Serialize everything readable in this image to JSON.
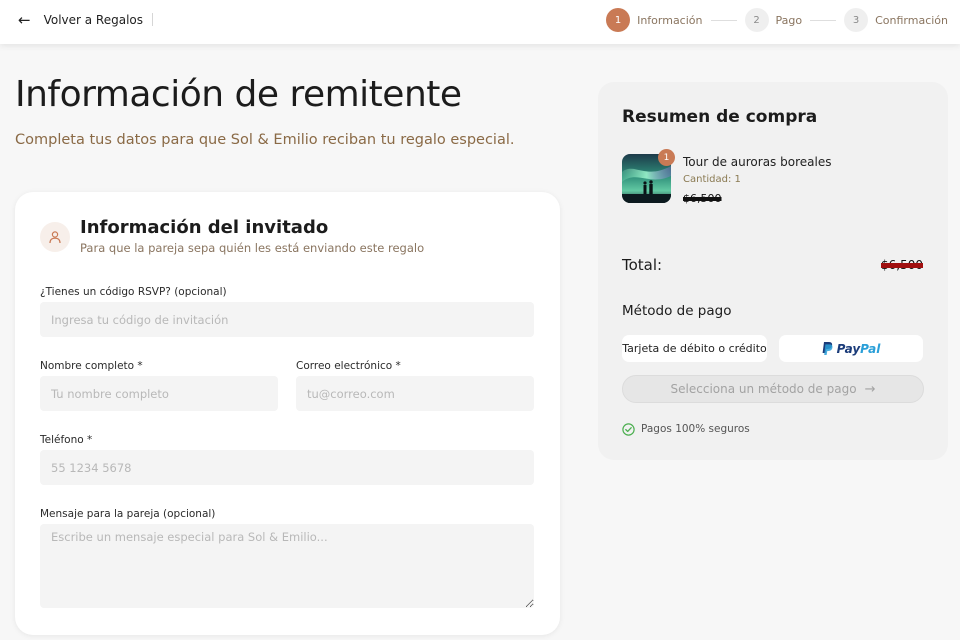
{
  "header": {
    "back_label": "Volver a Regalos",
    "steps": [
      {
        "num": "1",
        "label": "Información"
      },
      {
        "num": "2",
        "label": "Pago"
      },
      {
        "num": "3",
        "label": "Confirmación"
      }
    ],
    "active_step": 1,
    "accent_color": "#c97a55"
  },
  "page": {
    "title": "Información de remitente",
    "subtitle": "Completa tus datos para que Sol & Emilio reciban tu regalo especial."
  },
  "guest_card": {
    "title": "Información del invitado",
    "subtitle": "Para que la pareja sepa quién les está enviando este regalo",
    "icon": "user-icon",
    "fields": {
      "rsvp": {
        "label": "¿Tienes un código RSVP? (opcional)",
        "placeholder": "Ingresa tu código de invitación",
        "value": ""
      },
      "name": {
        "label": "Nombre completo *",
        "placeholder": "Tu nombre completo",
        "value": ""
      },
      "email": {
        "label": "Correo electrónico *",
        "placeholder": "tu@correo.com",
        "value": ""
      },
      "phone": {
        "label": "Teléfono *",
        "placeholder": "55 1234 5678",
        "value": ""
      },
      "message": {
        "label": "Mensaje para la pareja (opcional)",
        "placeholder": "Escribe un mensaje especial para Sol & Emilio...",
        "value": ""
      }
    }
  },
  "summary": {
    "title": "Resumen de compra",
    "item": {
      "name": "Tour de auroras boreales",
      "quantity_label": "Cantidad: 1",
      "badge": "1",
      "price": "$6,500"
    },
    "total_label": "Total:",
    "total_value": "$6,500",
    "payment_title": "Método de pago",
    "payment_options": {
      "card": "Tarjeta de débito o crédito",
      "paypal_part1": "Pay",
      "paypal_part2": "Pal"
    },
    "submit_label": "Selecciona un método de pago",
    "secure_label": "Pagos 100% seguros",
    "secure_color": "#4caf50"
  }
}
